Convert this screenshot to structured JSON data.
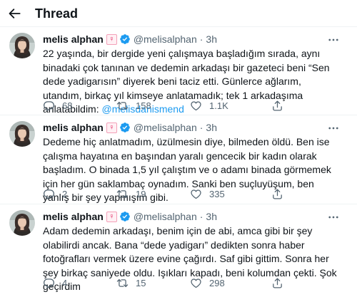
{
  "header": {
    "title": "Thread"
  },
  "tweets": [
    {
      "name": "melis alphan",
      "emoji": "♀",
      "handle": "@melisalphan",
      "time": "3h",
      "text_before": "22 yaşında, bir dergide yeni çalışmaya başladığım sırada, aynı binadaki çok tanınan ve dedemin arkadaşı bir gazeteci beni “Sen dede yadigarısın” diyerek beni taciz etti. Günlerce ağlarım, utandım, birkaç yıl kimseye anlatamadık; tek 1 arkadaşıma anlatabildim: ",
      "mention": "@melisdanismend",
      "reply_count": "68",
      "retweet_count": "158",
      "like_count": "1.1K"
    },
    {
      "name": "melis alphan",
      "emoji": "♀",
      "handle": "@melisalphan",
      "time": "3h",
      "text": "Dedeme hiç anlatmadım, üzülmesin diye, bilmeden öldü. Ben ise çalışma hayatına en başından yaralı gencecik bir kadın olarak başladım. O binada 1,5 yıl çalıştım ve o adamı binada görmemek için her gün saklambaç oynadım. Sanki ben suçluyüşum, ben yanlış bir şey yapmışım gibi.",
      "reply_count": "2",
      "retweet_count": "19",
      "like_count": "335"
    },
    {
      "name": "melis alphan",
      "emoji": "♀",
      "handle": "@melisalphan",
      "time": "3h",
      "text": "Adam dedemin arkadaşı, benim için de abi, amca gibi bir şey olabilirdi ancak. Bana “dede yadigarı” dedikten sonra haber fotoğrafları vermek üzere evine çağırdı. Saf gibi gittim. Sonra her şey birkaç saniyede oldu. Işıkları kapadı, beni kolumdan çekti. Şok geçirdim",
      "reply_count": "4",
      "retweet_count": "15",
      "like_count": "298"
    }
  ],
  "colors": {
    "accent": "#1d9bf0",
    "secondary_text": "#536471",
    "border": "#eff3f4"
  },
  "icons": [
    "back-arrow-icon",
    "verified-badge-icon",
    "more-icon",
    "reply-icon",
    "retweet-icon",
    "like-icon",
    "share-icon"
  ]
}
